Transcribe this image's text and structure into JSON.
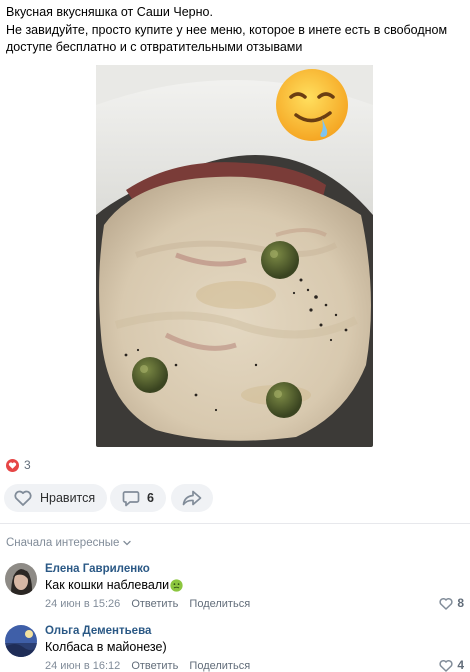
{
  "post": {
    "text_line1": "Вкусная вкусняшка от Саши Черно.",
    "text_line2": "Не завидуйте, просто купите у нее меню, которое в инете есть в свободном доступе бесплатно и с отвратительными отзывами",
    "photo_overlay_emoji": "drooling-face"
  },
  "reactions": {
    "icon": "heart-icon",
    "count": "3"
  },
  "actions": {
    "like_label": "Нравится",
    "comments_count": "6",
    "share_icon": "share-arrow-icon"
  },
  "comments_section": {
    "sort_label": "Сначала интересные"
  },
  "comments": [
    {
      "author": "Елена Гавриленко",
      "text": "Как кошки наблевали",
      "emoji": "nauseated-face",
      "date": "24 июн в 15:26",
      "reply": "Ответить",
      "share": "Поделиться",
      "likes": "8"
    },
    {
      "author": "Ольга Дементьева",
      "text": "Колбаса в майонезе)",
      "date": "24 июн в 16:12",
      "reply": "Ответить",
      "share": "Поделиться",
      "likes": "4"
    }
  ],
  "colors": {
    "link": "#2a5885",
    "secondary": "#818c99",
    "button_bg": "#f0f2f5",
    "heart": "#e64646"
  }
}
